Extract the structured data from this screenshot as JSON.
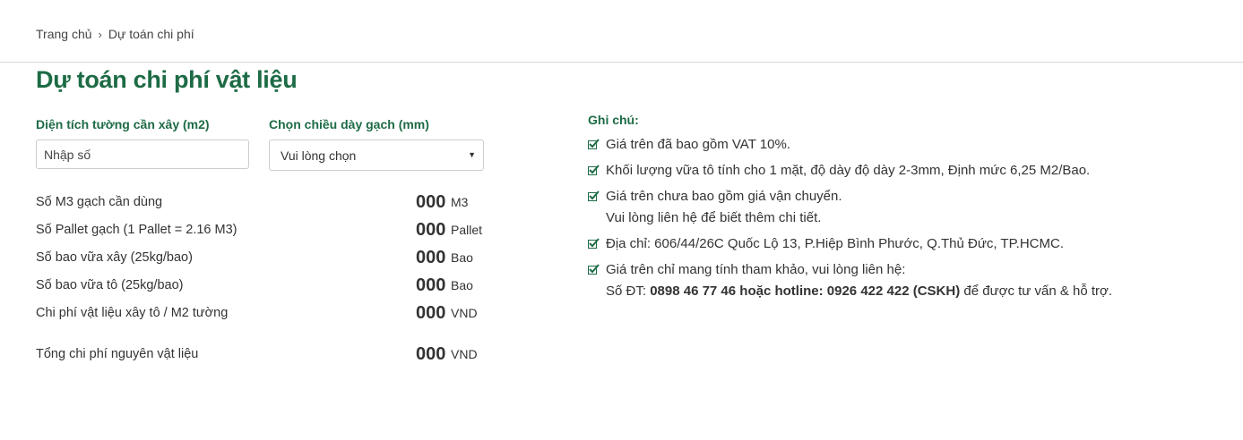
{
  "breadcrumb": {
    "home": "Trang chủ",
    "separator": "›",
    "current": "Dự toán chi phí"
  },
  "page": {
    "title": "Dự toán chi phí vật liệu"
  },
  "form": {
    "area_label": "Diện tích tường cần xây (m2)",
    "area_placeholder": "Nhập số",
    "thickness_label": "Chọn chiều dày gạch (mm)",
    "thickness_selected": "Vui lòng chọn"
  },
  "results": [
    {
      "label": "Số M3 gạch cần dùng",
      "value": "000",
      "unit": "M3"
    },
    {
      "label": "Số Pallet gạch (1 Pallet = 2.16 M3)",
      "value": "000",
      "unit": "Pallet"
    },
    {
      "label": "Số bao vữa xây (25kg/bao)",
      "value": "000",
      "unit": "Bao"
    },
    {
      "label": "Số bao vữa tô (25kg/bao)",
      "value": "000",
      "unit": "Bao"
    },
    {
      "label": "Chi phí vật liệu xây tô / M2 tường",
      "value": "000",
      "unit": "VND"
    }
  ],
  "total": {
    "label": "Tổng chi phí nguyên vật liệu",
    "value": "000",
    "unit": "VND"
  },
  "notes": {
    "title": "Ghi chú:",
    "items": [
      {
        "text": "Giá trên đã bao gồm VAT 10%."
      },
      {
        "text": "Khối lượng vữa tô tính cho 1 mặt, độ dày độ dày 2-3mm, Định mức 6,25 M2/Bao."
      },
      {
        "line1": "Giá trên chưa bao gồm giá vận chuyển.",
        "line2": "Vui lòng liên hệ để biết thêm chi tiết."
      },
      {
        "text": "Địa chỉ: 606/44/26C Quốc Lộ 13, P.Hiệp Bình Phước, Q.Thủ Đức, TP.HCMC."
      },
      {
        "line1": "Giá trên chỉ mang tính tham khảo, vui lòng liên hệ:",
        "line2_prefix": "Số ĐT: ",
        "line2_bold": "0898 46 77 46 hoặc hotline: 0926 422 422 (CSKH)",
        "line2_suffix": " để được tư vấn & hỗ trợ."
      }
    ]
  },
  "colors": {
    "accent": "#1d6b45",
    "text": "#333333",
    "border": "#cccccc"
  },
  "icons": {
    "note_check": "checkbox-checked-icon",
    "select_caret": "caret-down-icon",
    "breadcrumb_separator": "chevron-right-icon"
  }
}
